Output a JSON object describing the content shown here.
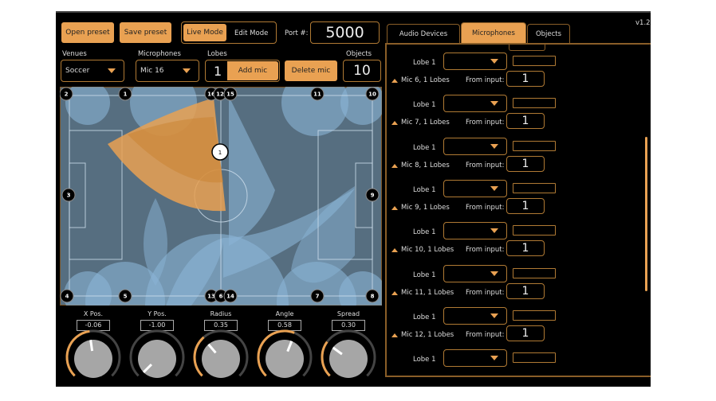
{
  "toolbar": {
    "open_preset": "Open preset",
    "save_preset": "Save preset",
    "live_mode": "Live Mode",
    "edit_mode": "Edit Mode",
    "port_label": "Port #:",
    "port_value": "5000"
  },
  "controls": {
    "venues_label": "Venues",
    "venue_value": "Soccer",
    "microphones_label": "Microphones",
    "microphone_value": "Mic 16",
    "lobes_label": "Lobes",
    "lobes_value": "1",
    "add_mic": "Add mic",
    "delete_mic": "Delete mic",
    "objects_label": "Objects",
    "objects_value": "10"
  },
  "field": {
    "selected_mic": "1",
    "mics": [
      "2",
      "1",
      "16",
      "12",
      "15",
      "11",
      "10",
      "3",
      "9",
      "4",
      "5",
      "13",
      "6",
      "14",
      "7",
      "8"
    ]
  },
  "knobs": [
    {
      "label": "X Pos.",
      "value": "-0.06",
      "fraction": 0.47
    },
    {
      "label": "Y Pos.",
      "value": "-1.00",
      "fraction": 0.0
    },
    {
      "label": "Radius",
      "value": "0.35",
      "fraction": 0.35
    },
    {
      "label": "Angle",
      "value": "0.58",
      "fraction": 0.58
    },
    {
      "label": "Spread",
      "value": "0.30",
      "fraction": 0.3
    }
  ],
  "version": "v1.2.",
  "tabs": [
    "Audio Devices",
    "Microphones",
    "Objects"
  ],
  "active_tab": "Microphones",
  "mic_list": {
    "lobe_label": "Lobe 1",
    "from_input_label": "From input:",
    "mics": [
      {
        "title": "Mic 6, 1 Lobes",
        "input": "1"
      },
      {
        "title": "Mic 7, 1 Lobes",
        "input": "1"
      },
      {
        "title": "Mic 8, 1 Lobes",
        "input": "1"
      },
      {
        "title": "Mic 9, 1 Lobes",
        "input": "1"
      },
      {
        "title": "Mic 10, 1 Lobes",
        "input": "1"
      },
      {
        "title": "Mic 11, 1 Lobes",
        "input": "1"
      },
      {
        "title": "Mic 12, 1 Lobes",
        "input": "1"
      }
    ]
  },
  "colors": {
    "accent": "#e9a152",
    "border": "#b07a34",
    "field": "#566e80",
    "lobe": "#8ab4d6"
  }
}
